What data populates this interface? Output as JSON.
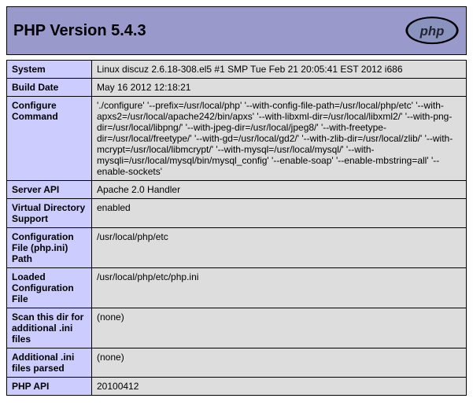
{
  "header": {
    "title": "PHP Version 5.4.3",
    "logo_alt": "php"
  },
  "rows": [
    {
      "label": "System",
      "value": "Linux discuz 2.6.18-308.el5 #1 SMP Tue Feb 21 20:05:41 EST 2012 i686"
    },
    {
      "label": "Build Date",
      "value": "May 16 2012 12:18:21"
    },
    {
      "label": "Configure Command",
      "value": "'./configure' '--prefix=/usr/local/php' '--with-config-file-path=/usr/local/php/etc' '--with-apxs2=/usr/local/apache242/bin/apxs' '--with-libxml-dir=/usr/local/libxml2/' '--with-png-dir=/usr/local/libpng/' '--with-jpeg-dir=/usr/local/jpeg8/' '--with-freetype-dir=/usr/local/freetype/' '--with-gd=/usr/local/gd2/' '--with-zlib-dir=/usr/local/zlib/' '--with-mcrypt=/usr/local/libmcrypt/' '--with-mysql=/usr/local/mysql/' '--with-mysqli=/usr/local/mysql/bin/mysql_config' '--enable-soap' '--enable-mbstring=all' '--enable-sockets'"
    },
    {
      "label": "Server API",
      "value": "Apache 2.0 Handler"
    },
    {
      "label": "Virtual Directory Support",
      "value": "enabled"
    },
    {
      "label": "Configuration File (php.ini) Path",
      "value": "/usr/local/php/etc"
    },
    {
      "label": "Loaded Configuration File",
      "value": "/usr/local/php/etc/php.ini"
    },
    {
      "label": "Scan this dir for additional .ini files",
      "value": "(none)"
    },
    {
      "label": "Additional .ini files parsed",
      "value": "(none)"
    },
    {
      "label": "PHP API",
      "value": "20100412"
    }
  ]
}
